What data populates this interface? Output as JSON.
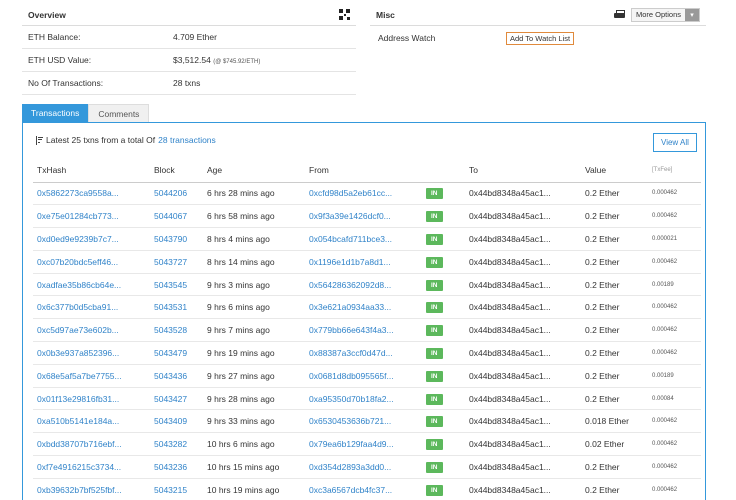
{
  "overview": {
    "title": "Overview",
    "rows": [
      {
        "label": "ETH Balance:",
        "value": "4.709 Ether",
        "sub": ""
      },
      {
        "label": "ETH USD Value:",
        "value": "$3,512.54",
        "sub": "(@ $745.92/ETH)"
      },
      {
        "label": "No Of Transactions:",
        "value": "28 txns",
        "sub": ""
      }
    ]
  },
  "misc": {
    "title": "Misc",
    "more_options": "More Options",
    "address_watch_label": "Address Watch",
    "add_watch_button": "Add To Watch List"
  },
  "tabs": [
    {
      "label": "Transactions",
      "active": true
    },
    {
      "label": "Comments",
      "active": false
    }
  ],
  "summary": {
    "prefix": "Latest 25 txns from a total Of",
    "link": "28 transactions"
  },
  "view_all_label": "View All",
  "table": {
    "headers": [
      "TxHash",
      "Block",
      "Age",
      "From",
      "",
      "To",
      "Value",
      "[TxFee]"
    ],
    "rows": [
      {
        "hash": "0x5862273ca9558a...",
        "block": "5044206",
        "age": "6 hrs 28 mins ago",
        "from": "0xcfd98d5a2eb61cc...",
        "dir": "IN",
        "to": "0x44bd8348a45ac1...",
        "value": "0.2 Ether",
        "fee": "0.000462"
      },
      {
        "hash": "0xe75e01284cb773...",
        "block": "5044067",
        "age": "6 hrs 58 mins ago",
        "from": "0x9f3a39e1426dcf0...",
        "dir": "IN",
        "to": "0x44bd8348a45ac1...",
        "value": "0.2 Ether",
        "fee": "0.000462"
      },
      {
        "hash": "0xd0ed9e9239b7c7...",
        "block": "5043790",
        "age": "8 hrs 4 mins ago",
        "from": "0x054bcafd711bce3...",
        "dir": "IN",
        "to": "0x44bd8348a45ac1...",
        "value": "0.2 Ether",
        "fee": "0.000021"
      },
      {
        "hash": "0xc07b20bdc5eff46...",
        "block": "5043727",
        "age": "8 hrs 14 mins ago",
        "from": "0x1196e1d1b7a8d1...",
        "dir": "IN",
        "to": "0x44bd8348a45ac1...",
        "value": "0.2 Ether",
        "fee": "0.000462"
      },
      {
        "hash": "0xadfae35b86cb64e...",
        "block": "5043545",
        "age": "9 hrs 3 mins ago",
        "from": "0x564286362092d8...",
        "dir": "IN",
        "to": "0x44bd8348a45ac1...",
        "value": "0.2 Ether",
        "fee": "0.00189"
      },
      {
        "hash": "0x6c377b0d5cba91...",
        "block": "5043531",
        "age": "9 hrs 6 mins ago",
        "from": "0x3e621a0934aa33...",
        "dir": "IN",
        "to": "0x44bd8348a45ac1...",
        "value": "0.2 Ether",
        "fee": "0.000462"
      },
      {
        "hash": "0xc5d97ae73e602b...",
        "block": "5043528",
        "age": "9 hrs 7 mins ago",
        "from": "0x779bb66e643f4a3...",
        "dir": "IN",
        "to": "0x44bd8348a45ac1...",
        "value": "0.2 Ether",
        "fee": "0.000462"
      },
      {
        "hash": "0x0b3e937a852396...",
        "block": "5043479",
        "age": "9 hrs 19 mins ago",
        "from": "0x88387a3ccf0d47d...",
        "dir": "IN",
        "to": "0x44bd8348a45ac1...",
        "value": "0.2 Ether",
        "fee": "0.000462"
      },
      {
        "hash": "0x68e5af5a7be7755...",
        "block": "5043436",
        "age": "9 hrs 27 mins ago",
        "from": "0x0681d8db095565f...",
        "dir": "IN",
        "to": "0x44bd8348a45ac1...",
        "value": "0.2 Ether",
        "fee": "0.00189"
      },
      {
        "hash": "0x01f13e29816fb31...",
        "block": "5043427",
        "age": "9 hrs 28 mins ago",
        "from": "0xa95350d70b18fa2...",
        "dir": "IN",
        "to": "0x44bd8348a45ac1...",
        "value": "0.2 Ether",
        "fee": "0.00084"
      },
      {
        "hash": "0xa510b5141e184a...",
        "block": "5043409",
        "age": "9 hrs 33 mins ago",
        "from": "0x6530453636b721...",
        "dir": "IN",
        "to": "0x44bd8348a45ac1...",
        "value": "0.018 Ether",
        "fee": "0.000462"
      },
      {
        "hash": "0xbdd38707b716ebf...",
        "block": "5043282",
        "age": "10 hrs 6 mins ago",
        "from": "0x79ea6b129faa4d9...",
        "dir": "IN",
        "to": "0x44bd8348a45ac1...",
        "value": "0.02 Ether",
        "fee": "0.000462"
      },
      {
        "hash": "0xf7e4916215c3734...",
        "block": "5043236",
        "age": "10 hrs 15 mins ago",
        "from": "0xd354d2893a3dd0...",
        "dir": "IN",
        "to": "0x44bd8348a45ac1...",
        "value": "0.2 Ether",
        "fee": "0.000462"
      },
      {
        "hash": "0xb39632b7bf525fbf...",
        "block": "5043215",
        "age": "10 hrs 19 mins ago",
        "from": "0xc3a6567dcb4fc37...",
        "dir": "IN",
        "to": "0x44bd8348a45ac1...",
        "value": "0.2 Ether",
        "fee": "0.000462"
      }
    ]
  },
  "colors": {
    "accent": "#3498db",
    "link": "#3083c9",
    "in_badge": "#5cb85c",
    "watch_border": "#e08a3c"
  },
  "icons": [
    "qr-code-icon",
    "print-icon",
    "chevron-down-icon",
    "sort-icon"
  ]
}
